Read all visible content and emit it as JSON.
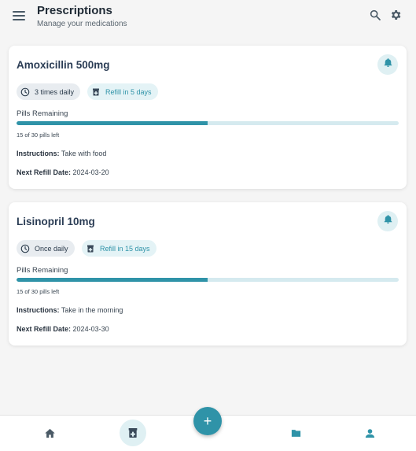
{
  "header": {
    "title": "Prescriptions",
    "subtitle": "Manage your medications",
    "icons": [
      "menu-icon",
      "search-icon",
      "gear-icon"
    ]
  },
  "colors": {
    "accent": "#2f93a8",
    "accent_light": "#dff0f3",
    "title_text": "#2b3d55",
    "background": "#f5f5f5"
  },
  "medications": [
    {
      "name": "Amoxicillin 500mg",
      "frequency": "3 times daily",
      "refill_badge": "Refill in 5 days",
      "pills_label": "Pills Remaining",
      "pills_fraction": 0.5,
      "pills_text": "15 of 30 pills left",
      "instructions_label": "Instructions:",
      "instructions": "Take with food",
      "refill_date_label": "Next Refill Date:",
      "refill_date": "2024-03-20"
    },
    {
      "name": "Lisinopril 10mg",
      "frequency": "Once daily",
      "refill_badge": "Refill in 15 days",
      "pills_label": "Pills Remaining",
      "pills_fraction": 0.5,
      "pills_text": "15 of 30 pills left",
      "instructions_label": "Instructions:",
      "instructions": "Take in the morning",
      "refill_date_label": "Next Refill Date:",
      "refill_date": "2024-03-30"
    }
  ],
  "bottom_nav": {
    "items": [
      "home-icon",
      "prescription-icon",
      "add-icon",
      "folder-icon",
      "profile-icon"
    ],
    "active": "prescription-icon",
    "fab_label": "+"
  }
}
